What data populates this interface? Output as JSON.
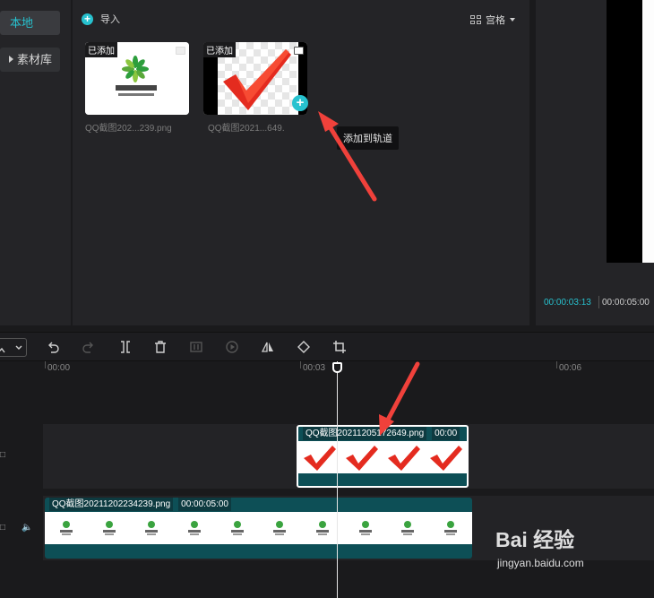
{
  "sidebar": {
    "items": [
      {
        "label": "本地",
        "active": true
      },
      {
        "label": "素材库",
        "active": false
      }
    ]
  },
  "media": {
    "import_label": "导入",
    "view_label": "宫格",
    "cards": [
      {
        "badge": "已添加",
        "filename": "QQ截图202...239.png",
        "thumbnail": "logo-image"
      },
      {
        "badge": "已添加",
        "filename": "QQ截图2021...649.",
        "thumbnail": "red-checkmark-image"
      }
    ],
    "tooltip": "添加到轨道"
  },
  "preview": {
    "current_time": "00:00:03:13",
    "total_time": "00:00:05:00"
  },
  "toolbar": {
    "icons": [
      "select-icon",
      "undo-icon",
      "redo-icon",
      "split-icon",
      "delete-icon",
      "freeze-icon",
      "play-icon",
      "mirror-icon",
      "rotate-icon",
      "crop-icon"
    ]
  },
  "ruler": {
    "labels": [
      "00:00",
      "00:03",
      "00:06"
    ]
  },
  "timeline": {
    "clip_top": {
      "name": "QQ截图20211205172649.png",
      "duration": "00:00"
    },
    "clip_bottom": {
      "name": "QQ截图20211202234239.png",
      "duration": "00:00:05:00"
    }
  },
  "watermark": {
    "title": "Bai 经验",
    "subtitle": "jingyan.baidu.com"
  },
  "colors": {
    "accent": "#27c2cf",
    "clip": "#0d4f56",
    "arrow": "#f0413b"
  }
}
